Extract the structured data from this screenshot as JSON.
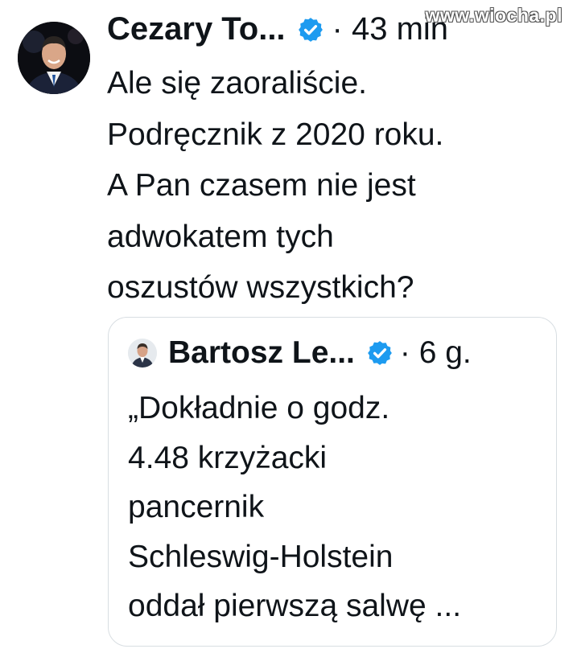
{
  "watermark": "www.wiocha.pl",
  "tweet": {
    "author_name": "Cezary To...",
    "meta": "· 43 min",
    "lines": [
      "Ale się zaoraliście.",
      "Podręcznik z 2020 roku.",
      "A Pan czasem nie jest",
      "adwokatem tych",
      "oszustów wszystkich?"
    ]
  },
  "quote": {
    "author_name": "Bartosz Le...",
    "meta": "· 6 g.",
    "lines": [
      "„Dokładnie o godz.",
      "4.48 krzyżacki",
      "pancernik",
      "Schleswig-Holstein",
      "oddał pierwszą salwę ..."
    ]
  },
  "icons": {
    "verified": "verified-badge-icon",
    "avatar": "avatar"
  },
  "colors": {
    "verified_blue": "#1d9bf0",
    "text": "#0f1419",
    "border": "#d8dee2"
  }
}
